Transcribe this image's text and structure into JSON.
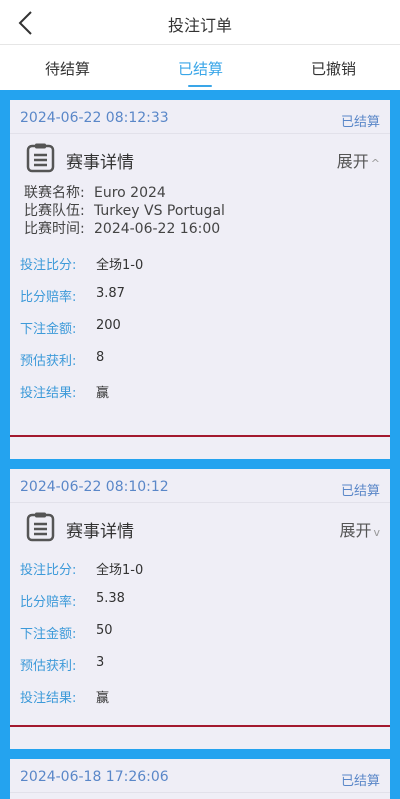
{
  "header": {
    "title": "投注订单"
  },
  "tabs": [
    {
      "label": "待结算"
    },
    {
      "label": "已结算"
    },
    {
      "label": "已撤销"
    }
  ],
  "active_tab": 1,
  "orders": [
    {
      "time": "2024-06-22 08:12:33",
      "status": "已结算",
      "detail_title": "赛事详情",
      "toggle_label": "展开",
      "match": {
        "league_label": "联赛名称:",
        "league": "Euro 2024",
        "teams_label": "比赛队伍:",
        "teams": "Turkey VS Portugal",
        "match_time_label": "比赛时间:",
        "match_time": "2024-06-22 16:00"
      },
      "fields": [
        {
          "label": "投注比分:",
          "value": "全场1-0"
        },
        {
          "label": "比分赔率:",
          "value": "3.87"
        },
        {
          "label": "下注金额:",
          "value": "200"
        },
        {
          "label": "预估获利:",
          "value": "8"
        },
        {
          "label": "投注结果:",
          "value": "赢"
        }
      ]
    },
    {
      "time": "2024-06-22 08:10:12",
      "status": "已结算",
      "detail_title": "赛事详情",
      "toggle_label": "展开",
      "fields": [
        {
          "label": "投注比分:",
          "value": "全场1-0"
        },
        {
          "label": "比分赔率:",
          "value": "5.38"
        },
        {
          "label": "下注金额:",
          "value": "50"
        },
        {
          "label": "预估获利:",
          "value": "3"
        },
        {
          "label": "投注结果:",
          "value": "赢"
        }
      ]
    },
    {
      "time": "2024-06-18 17:26:06",
      "status": "已结算"
    }
  ],
  "colors": {
    "accent": "#3aa6e8",
    "list_bg": "#24a3ef",
    "card_bg": "#efeef6",
    "divider": "#a3192e"
  }
}
